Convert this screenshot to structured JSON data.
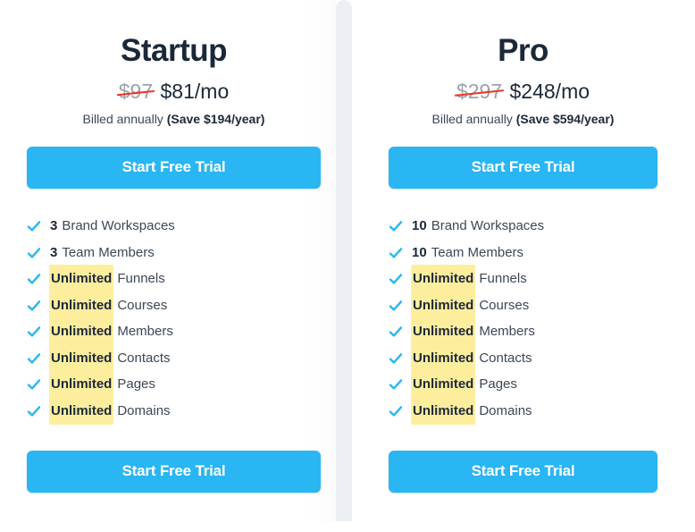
{
  "colors": {
    "cta_blue": "#29b6f2",
    "check_blue": "#29b6f2",
    "highlight_yellow": "#fdee9e",
    "strike_red": "#ef3124",
    "heading_navy": "#1b2838",
    "body_gray": "#3b4757",
    "old_price_gray": "#9aa3ae",
    "panel_gray": "#eceff4"
  },
  "plans": [
    {
      "name": "Startup",
      "old_price": "$97",
      "new_price": "$81/mo",
      "billed_text": "Billed annually",
      "save_text": "(Save $194/year)",
      "cta_top_label": "Start Free Trial",
      "cta_bottom_label": "Start Free Trial",
      "features": [
        {
          "qty": "3",
          "highlight": false,
          "label": "Brand Workspaces",
          "icon": "check-icon"
        },
        {
          "qty": "3",
          "highlight": false,
          "label": "Team Members",
          "icon": "check-icon"
        },
        {
          "qty": "Unlimited",
          "highlight": true,
          "label": "Funnels",
          "icon": "check-icon"
        },
        {
          "qty": "Unlimited",
          "highlight": true,
          "label": "Courses",
          "icon": "check-icon"
        },
        {
          "qty": "Unlimited",
          "highlight": true,
          "label": "Members",
          "icon": "check-icon"
        },
        {
          "qty": "Unlimited",
          "highlight": true,
          "label": "Contacts",
          "icon": "check-icon"
        },
        {
          "qty": "Unlimited",
          "highlight": true,
          "label": "Pages",
          "icon": "check-icon"
        },
        {
          "qty": "Unlimited",
          "highlight": true,
          "label": "Domains",
          "icon": "check-icon"
        }
      ]
    },
    {
      "name": "Pro",
      "old_price": "$297",
      "new_price": "$248/mo",
      "billed_text": "Billed annually",
      "save_text": "(Save $594/year)",
      "cta_top_label": "Start Free Trial",
      "cta_bottom_label": "Start Free Trial",
      "features": [
        {
          "qty": "10",
          "highlight": false,
          "label": "Brand Workspaces",
          "icon": "check-icon"
        },
        {
          "qty": "10",
          "highlight": false,
          "label": "Team Members",
          "icon": "check-icon"
        },
        {
          "qty": "Unlimited",
          "highlight": true,
          "label": "Funnels",
          "icon": "check-icon"
        },
        {
          "qty": "Unlimited",
          "highlight": true,
          "label": "Courses",
          "icon": "check-icon"
        },
        {
          "qty": "Unlimited",
          "highlight": true,
          "label": "Members",
          "icon": "check-icon"
        },
        {
          "qty": "Unlimited",
          "highlight": true,
          "label": "Contacts",
          "icon": "check-icon"
        },
        {
          "qty": "Unlimited",
          "highlight": true,
          "label": "Pages",
          "icon": "check-icon"
        },
        {
          "qty": "Unlimited",
          "highlight": true,
          "label": "Domains",
          "icon": "check-icon"
        }
      ]
    }
  ]
}
